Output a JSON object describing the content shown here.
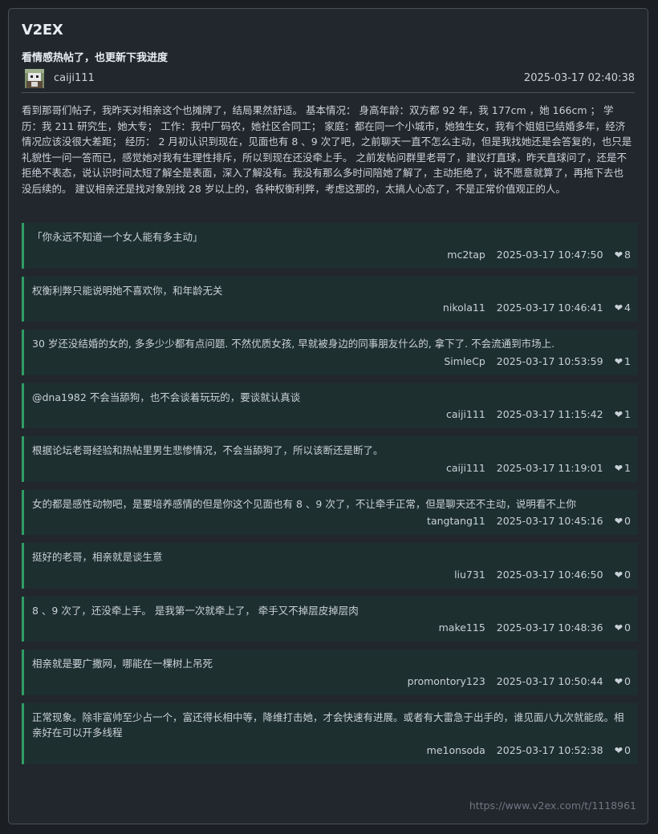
{
  "site": "V2EX",
  "post": {
    "title": "看情感热帖了，也更新下我进度",
    "author": "caiji111",
    "time": "2025-03-17 02:40:38",
    "content": "看到那哥们帖子，我昨天对相亲这个也摊牌了，结局果然舒适。 基本情况： 身高年龄：双方都 92 年，我 177cm ，她 166cm ； 学历：我 211 研究生，她大专； 工作：我中厂码农，她社区合同工； 家庭：都在同一个小城市，她独生女，我有个姐姐已结婚多年，经济情况应该没很大差距； 经历： 2 月初认识到现在，见面也有 8 、9 次了吧，之前聊天一直不怎么主动，但是我找她还是会答复的，也只是礼貌性一问一答而已，感觉她对我有生理性排斥，所以到现在还没牵上手。 之前发帖问群里老哥了，建议打直球，昨天直球问了，还是不拒绝不表态，说认识时间太短了解全是表面，深入了解没有。我没有那么多时间陪她了解了，主动拒绝了，说不愿意就算了，再拖下去也没后续的。 建议相亲还是找对象别找 28 岁以上的，各种权衡利弊，考虑这那的，太搞人心态了，不是正常价值观正的人。"
  },
  "replies": [
    {
      "text": "「你永远不知道一个女人能有多主动」",
      "user": "mc2tap",
      "time": "2025-03-17 10:47:50",
      "likes": "8"
    },
    {
      "text": "权衡利弊只能说明她不喜欢你，和年龄无关",
      "user": "nikola11",
      "time": "2025-03-17 10:46:41",
      "likes": "4"
    },
    {
      "text": "30 岁还没结婚的女的, 多多少少都有点问题. 不然优质女孩, 早就被身边的同事朋友什么的, 拿下了. 不会流通到市场上.",
      "user": "SimleCp",
      "time": "2025-03-17 10:53:59",
      "likes": "1"
    },
    {
      "text": "@dna1982 不会当舔狗，也不会谈着玩玩的，要谈就认真谈",
      "user": "caiji111",
      "time": "2025-03-17 11:15:42",
      "likes": "1"
    },
    {
      "text": "根据论坛老哥经验和热帖里男生悲惨情况，不会当舔狗了，所以该断还是断了。",
      "user": "caiji111",
      "time": "2025-03-17 11:19:01",
      "likes": "1"
    },
    {
      "text": "女的都是感性动物吧，是要培养感情的但是你这个见面也有 8 、9 次了，不让牵手正常，但是聊天还不主动，说明看不上你",
      "user": "tangtang11",
      "time": "2025-03-17 10:45:16",
      "likes": "0"
    },
    {
      "text": "挺好的老哥，相亲就是谈生意",
      "user": "liu731",
      "time": "2025-03-17 10:46:50",
      "likes": "0"
    },
    {
      "text": "8 、9 次了，还没牵上手。 是我第一次就牵上了， 牵手又不掉层皮掉层肉",
      "user": "make115",
      "time": "2025-03-17 10:48:36",
      "likes": "0"
    },
    {
      "text": "相亲就是要广撒网，哪能在一棵树上吊死",
      "user": "promontory123",
      "time": "2025-03-17 10:50:44",
      "likes": "0"
    },
    {
      "text": "正常现象。除非富帅至少占一个，富还得长相中等，降维打击她，才会快速有进展。或者有大雷急于出手的，谁见面八九次就能成。相亲好在可以开多线程",
      "user": "me1onsoda",
      "time": "2025-03-17 10:52:38",
      "likes": "0"
    }
  ],
  "source_url": "https://www.v2ex.com/t/1118961",
  "icons": {
    "heart": "heart-icon",
    "avatar": "pixel-avatar"
  },
  "colors": {
    "accent": "#2e9e64",
    "reply_bg": "#1e2f2f",
    "card_bg": "#22272e"
  }
}
